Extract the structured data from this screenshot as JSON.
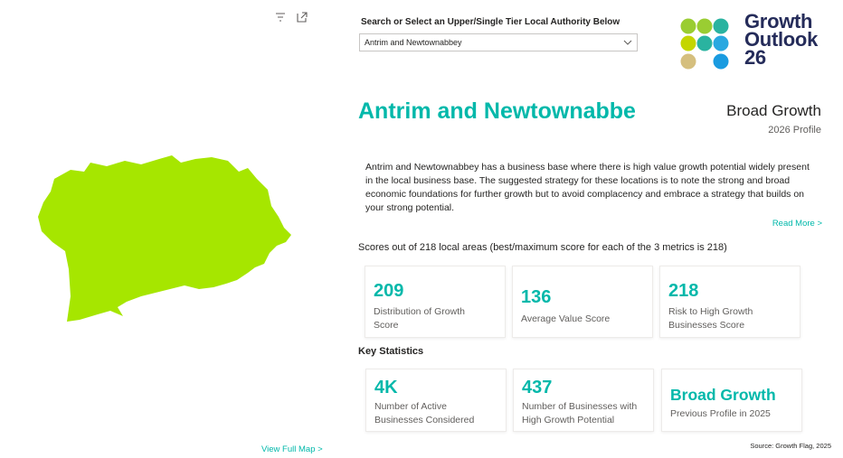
{
  "map": {
    "toolbar": {
      "filter_icon": "filter-icon",
      "expand_icon": "focus-mode-icon"
    },
    "shape_color": "#a6e600",
    "view_full_map": "View Full Map >"
  },
  "slicer": {
    "label": "Search or Select an Upper/Single Tier Local Authority Below",
    "value": "Antrim and Newtownabbey"
  },
  "logo": {
    "line1": "Growth",
    "line2": "Outlook",
    "line3": "26"
  },
  "header": {
    "title": "Antrim and Newtownabbe",
    "profile": "Broad Growth",
    "profile_sub": "2026 Profile"
  },
  "description": "Antrim and Newtownabbey has a business base where there is high value growth potential widely present in the local business base. The suggested strategy for these locations is to note the strong and broad economic foundations for further growth but to avoid complacency and embrace a strategy that builds on your strong potential.",
  "read_more": "Read More >",
  "scores": {
    "heading": "Scores out of 218 local areas (best/maximum score for each of the 3 metrics is 218)",
    "cards": [
      {
        "value": "209",
        "label": "Distribution of Growth Score"
      },
      {
        "value": "136",
        "label": "Average Value Score"
      },
      {
        "value": "218",
        "label": "Risk to High Growth Businesses Score"
      }
    ]
  },
  "key_stats": {
    "heading": "Key Statistics",
    "cards": [
      {
        "value": "4K",
        "label": "Number of Active Businesses Considered"
      },
      {
        "value": "437",
        "label": "Number of Businesses with High Growth Potential"
      },
      {
        "value": "Broad Growth",
        "label": "Previous Profile in 2025"
      }
    ]
  },
  "source": "Source: Growth Flag, 2025",
  "colors": {
    "accent": "#01b8aa",
    "navy": "#252c5a",
    "map": "#a6e600"
  }
}
